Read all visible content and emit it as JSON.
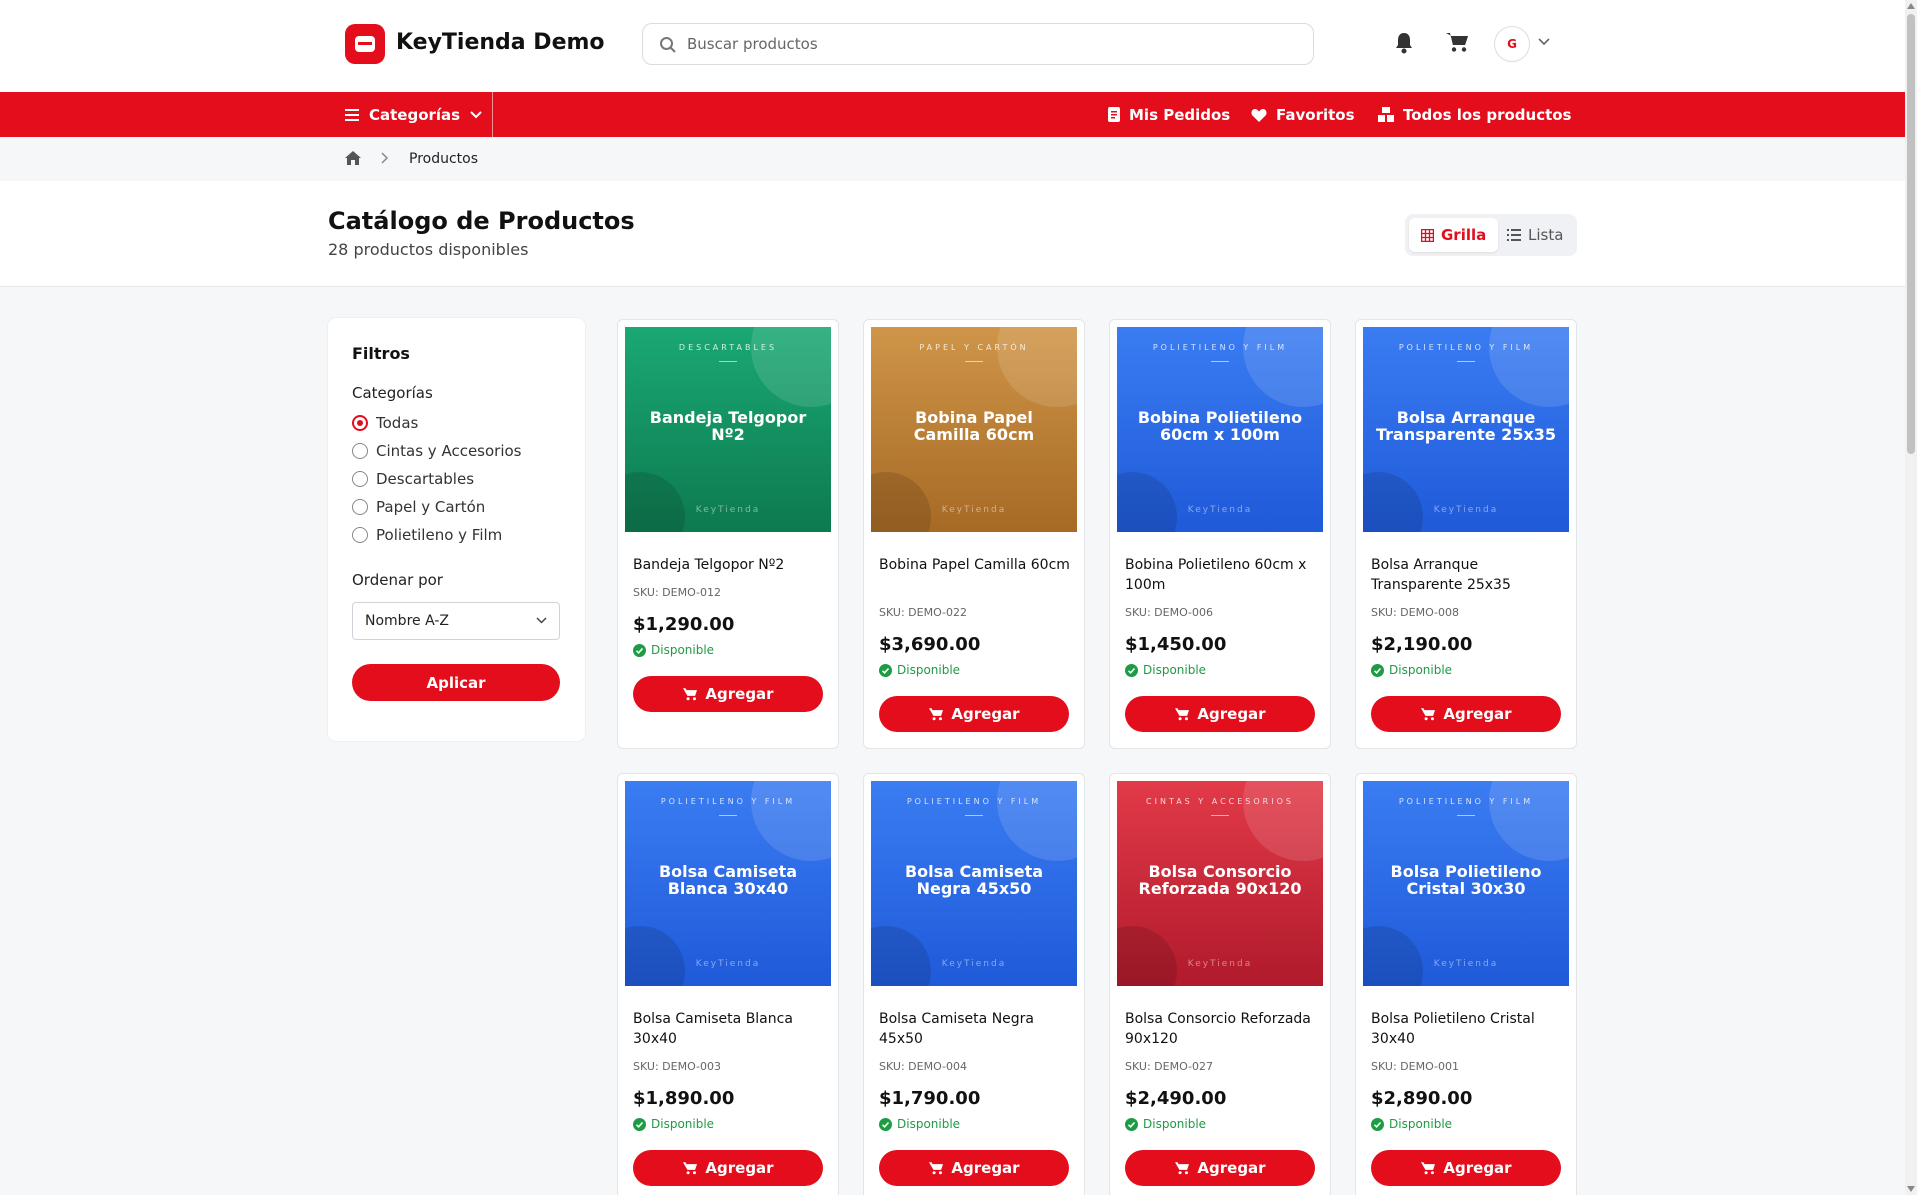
{
  "header": {
    "brand": "KeyTienda Demo",
    "search_placeholder": "Buscar productos",
    "user_initial": "G"
  },
  "nav": {
    "categories": "Categorías",
    "orders": "Mis Pedidos",
    "favorites": "Favoritos",
    "all_products": "Todos los productos"
  },
  "breadcrumb": {
    "current": "Productos"
  },
  "page": {
    "title": "Catálogo de Productos",
    "subtitle": "28 productos disponibles",
    "view_grid": "Grilla",
    "view_list": "Lista"
  },
  "filters": {
    "title": "Filtros",
    "categories_label": "Categorías",
    "options": [
      "Todas",
      "Cintas y Accesorios",
      "Descartables",
      "Papel y Cartón",
      "Polietileno y Film"
    ],
    "selected": "Todas",
    "sort_label": "Ordenar por",
    "sort_value": "Nombre A-Z",
    "apply": "Aplicar"
  },
  "colors": {
    "accent": "#e30d1c",
    "descartables": "#17a06a",
    "papel": "#c48a3c",
    "polietileno": "#2f6fe8",
    "cintas": "#d7283a",
    "available": "#1e9b45"
  },
  "products": [
    {
      "thumb_cat": "DESCARTABLES",
      "thumb_name": "Bandeja Telgopor Nº2",
      "name": "Bandeja Telgopor Nº2",
      "sku": "SKU: DEMO-012",
      "price": "$1,290.00",
      "stock": "Disponible",
      "button": "Agregar"
    },
    {
      "thumb_cat": "PAPEL Y CARTÓN",
      "thumb_name": "Bobina Papel Camilla 60cm",
      "name": "Bobina Papel Camilla 60cm",
      "sku": "SKU: DEMO-022",
      "price": "$3,690.00",
      "stock": "Disponible",
      "button": "Agregar"
    },
    {
      "thumb_cat": "POLIETILENO Y FILM",
      "thumb_name": "Bobina Polietileno 60cm x 100m",
      "name": "Bobina Polietileno 60cm x 100m",
      "sku": "SKU: DEMO-006",
      "price": "$1,450.00",
      "stock": "Disponible",
      "button": "Agregar"
    },
    {
      "thumb_cat": "POLIETILENO Y FILM",
      "thumb_name": "Bolsa Arranque Transparente 25x35",
      "name": "Bolsa Arranque Transparente 25x35",
      "sku": "SKU: DEMO-008",
      "price": "$2,190.00",
      "stock": "Disponible",
      "button": "Agregar"
    },
    {
      "thumb_cat": "POLIETILENO Y FILM",
      "thumb_name": "Bolsa Camiseta Blanca 30x40",
      "name": "Bolsa Camiseta Blanca 30x40",
      "sku": "SKU: DEMO-003",
      "price": "$1,890.00",
      "stock": "Disponible",
      "button": "Agregar"
    },
    {
      "thumb_cat": "POLIETILENO Y FILM",
      "thumb_name": "Bolsa Camiseta Negra 45x50",
      "name": "Bolsa Camiseta Negra 45x50",
      "sku": "SKU: DEMO-004",
      "price": "$1,790.00",
      "stock": "Disponible",
      "button": "Agregar"
    },
    {
      "thumb_cat": "CINTAS Y ACCESORIOS",
      "thumb_name": "Bolsa Consorcio Reforzada 90x120",
      "name": "Bolsa Consorcio Reforzada 90x120",
      "sku": "SKU: DEMO-027",
      "price": "$2,490.00",
      "stock": "Disponible",
      "button": "Agregar"
    },
    {
      "thumb_cat": "POLIETILENO Y FILM",
      "thumb_name": "Bolsa Polietileno Cristal 30x30",
      "name": "Bolsa Polietileno Cristal 30x40",
      "sku": "SKU: DEMO-001",
      "price": "$2,890.00",
      "stock": "Disponible",
      "button": "Agregar"
    }
  ],
  "thumb_brand": "KeyTienda"
}
